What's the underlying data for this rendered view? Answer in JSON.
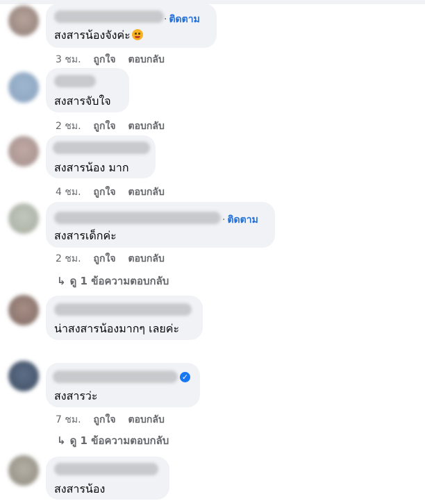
{
  "comments": [
    {
      "text": "สงสารน้องจังค่ะ",
      "follow": "ติดตาม",
      "time": "3 ชม.",
      "like": "ถูกใจ",
      "reply": "ตอบกลับ",
      "emoji": "crying-face-icon"
    },
    {
      "text": "สงสารจับใจ",
      "time": "2 ชม.",
      "like": "ถูกใจ",
      "reply": "ตอบกลับ"
    },
    {
      "text": "สงสารน้อง มาก",
      "time": "4 ชม.",
      "like": "ถูกใจ",
      "reply": "ตอบกลับ"
    },
    {
      "text": "สงสารเด็กค่ะ",
      "follow": "ติดตาม",
      "time": "2 ชม.",
      "like": "ถูกใจ",
      "reply": "ตอบกลับ",
      "view_replies": "ดู 1 ข้อความตอบกลับ"
    },
    {
      "text": "น่าสงสารน้องมากๆ เลยค่ะ"
    },
    {
      "text": "สงสารว่ะ",
      "verified": true,
      "time": "7 ชม.",
      "like": "ถูกใจ",
      "reply": "ตอบกลับ",
      "view_replies": "ดู 1 ข้อความตอบกลับ"
    },
    {
      "text": "สงสารน้อง"
    }
  ],
  "colors": {
    "link": "#216fdb",
    "meta": "#65676b",
    "bubble": "#f0f2f5",
    "verified": "#1877f2"
  }
}
